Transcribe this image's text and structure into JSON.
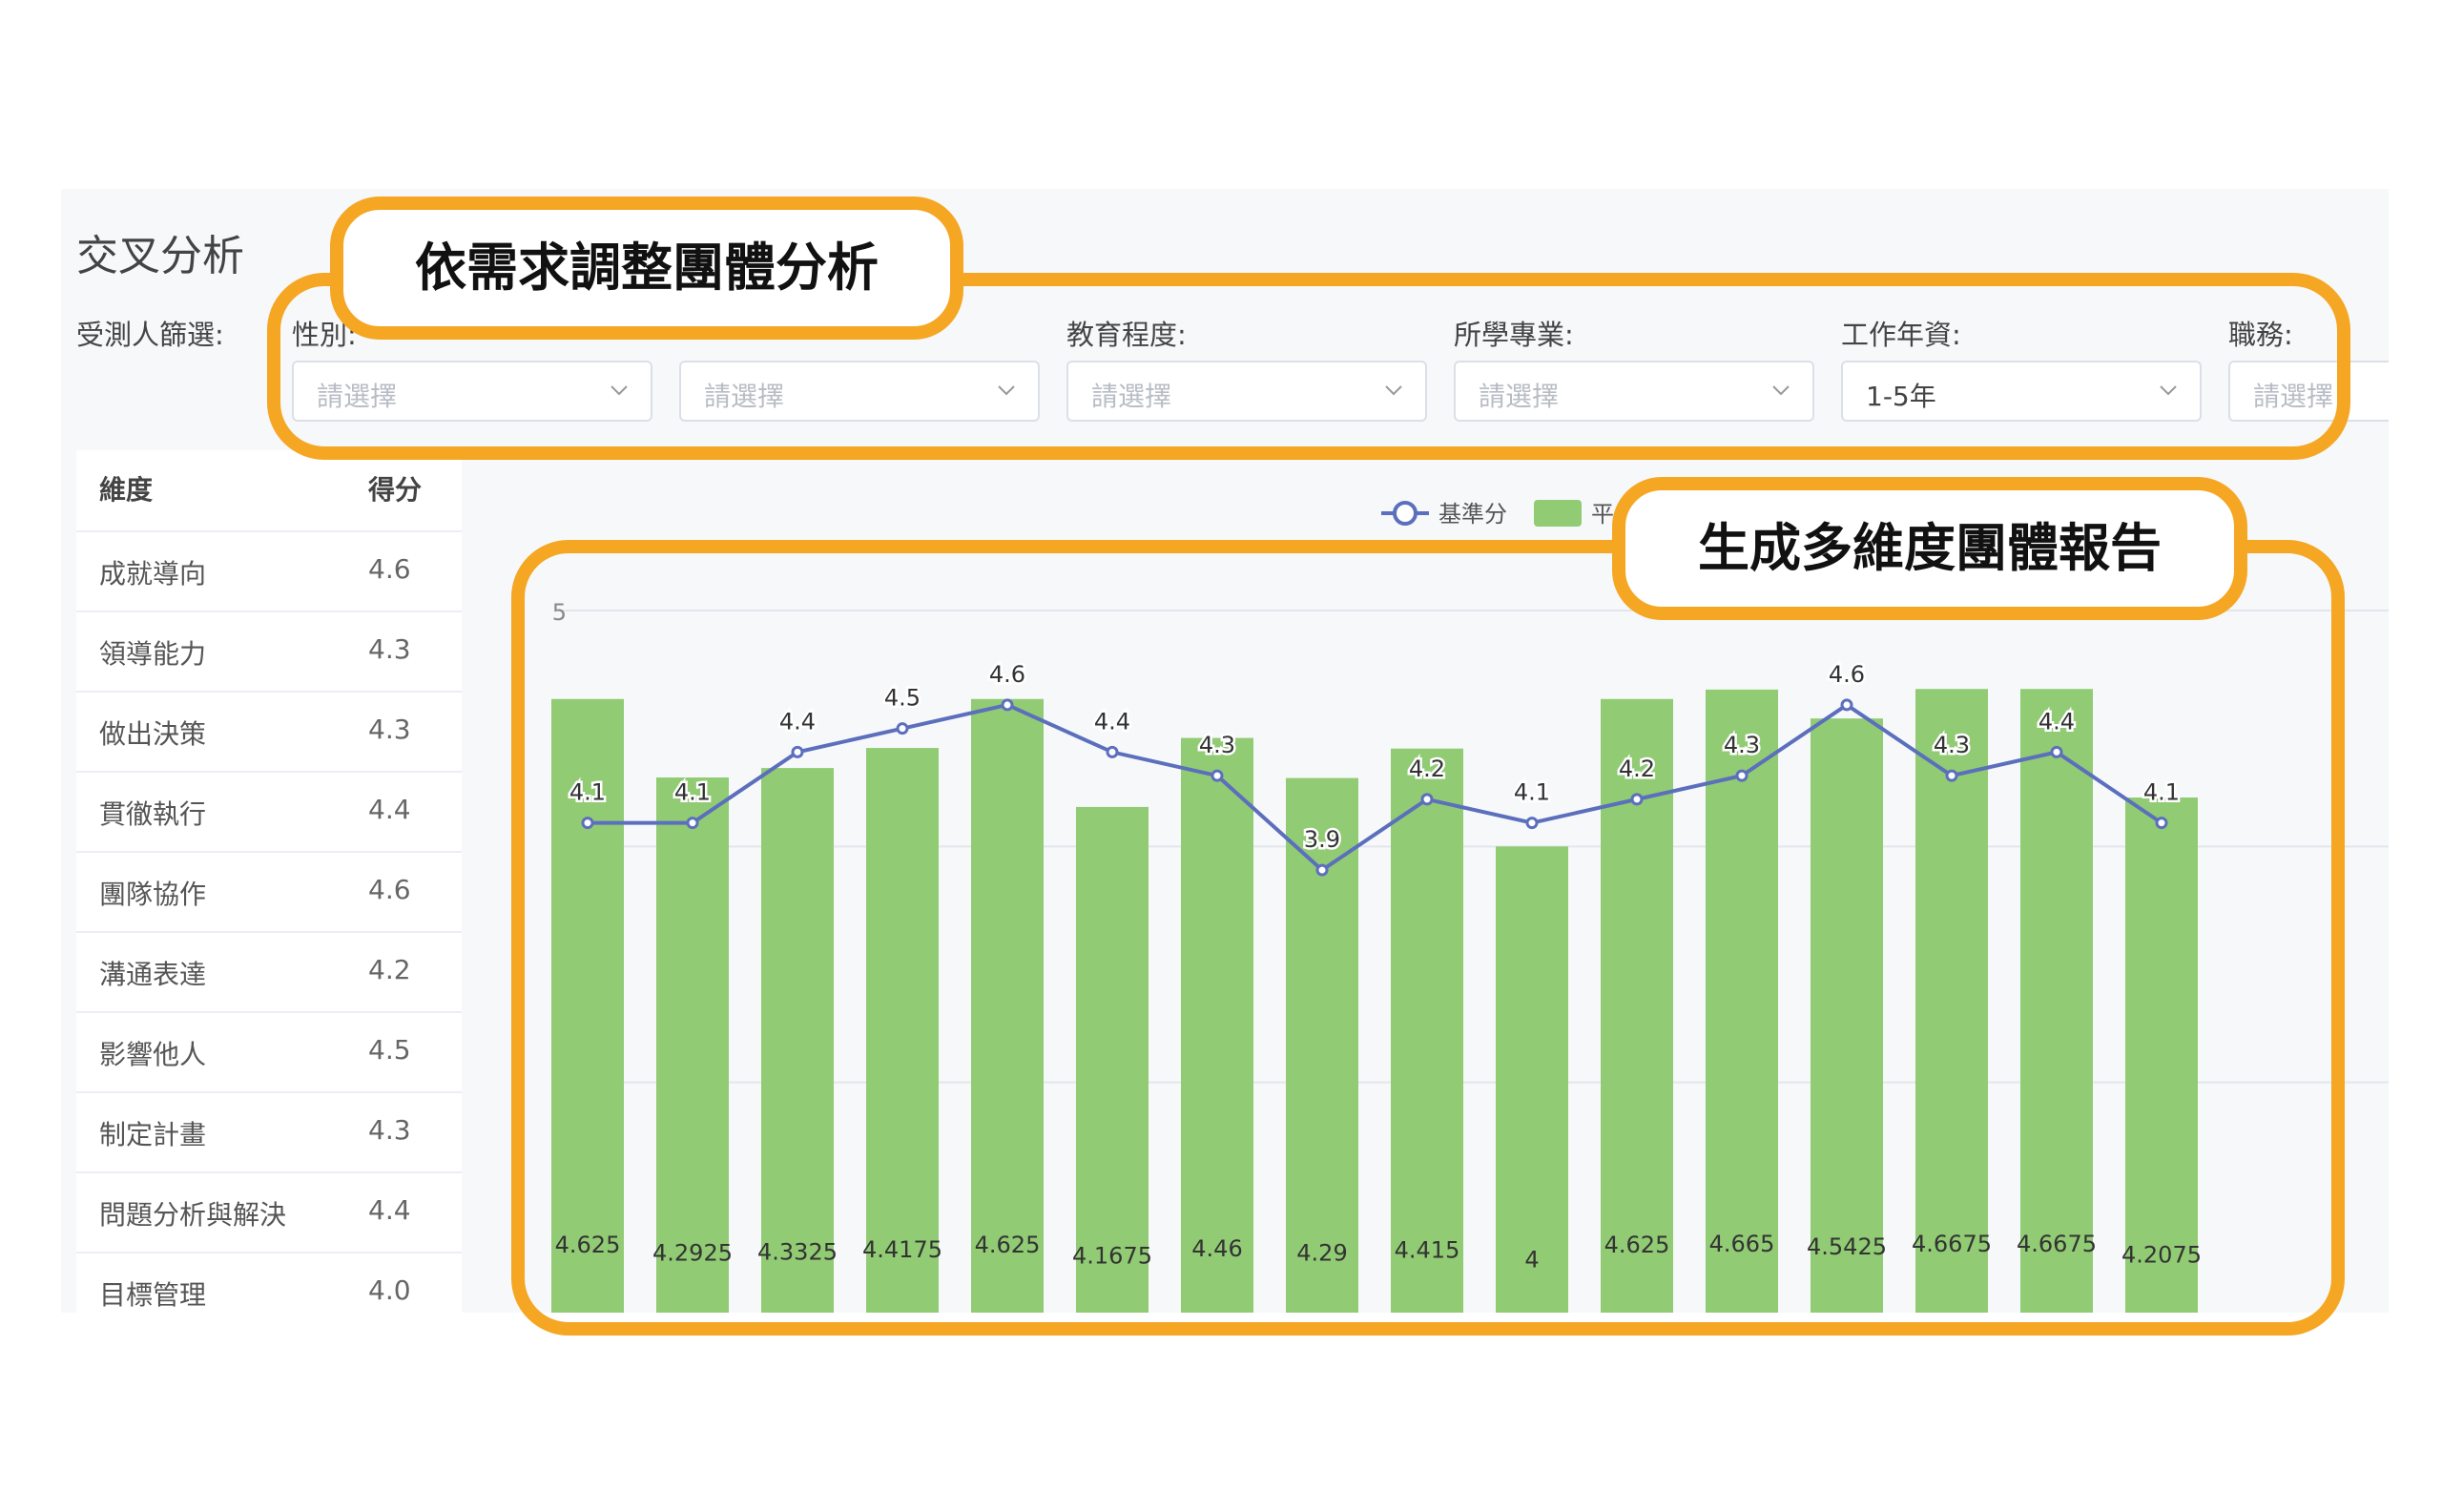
{
  "page": {
    "title": "交叉分析"
  },
  "filters": {
    "label": "受測人篩選:",
    "items": [
      {
        "label": "性別:",
        "value": "請選擇",
        "filled": false
      },
      {
        "label": "",
        "value": "請選擇",
        "filled": false
      },
      {
        "label": "教育程度:",
        "value": "請選擇",
        "filled": false
      },
      {
        "label": "所學專業:",
        "value": "請選擇",
        "filled": false
      },
      {
        "label": "工作年資:",
        "value": "1-5年",
        "filled": true
      },
      {
        "label": "職務:",
        "value": "請選擇",
        "filled": false
      }
    ]
  },
  "table": {
    "headers": {
      "dimension": "維度",
      "score": "得分"
    },
    "rows": [
      {
        "dimension": "成就導向",
        "score": "4.6"
      },
      {
        "dimension": "領導能力",
        "score": "4.3"
      },
      {
        "dimension": "做出決策",
        "score": "4.3"
      },
      {
        "dimension": "貫徹執行",
        "score": "4.4"
      },
      {
        "dimension": "團隊協作",
        "score": "4.6"
      },
      {
        "dimension": "溝通表達",
        "score": "4.2"
      },
      {
        "dimension": "影響他人",
        "score": "4.5"
      },
      {
        "dimension": "制定計畫",
        "score": "4.3"
      },
      {
        "dimension": "問題分析與解決",
        "score": "4.4"
      },
      {
        "dimension": "目標管理",
        "score": "4.0"
      }
    ]
  },
  "callouts": {
    "filter_note": "依需求調整團體分析",
    "report_note": "生成多維度團體報告"
  },
  "colors": {
    "bar": "#91cb74",
    "line": "#5b6fbd",
    "highlight": "#f5a623"
  },
  "chart_data": {
    "type": "bar",
    "legend": {
      "position": "top-center",
      "entries": [
        "基準分",
        "平"
      ]
    },
    "ylim": [
      2,
      5
    ],
    "yticks": [
      2,
      3,
      4,
      5
    ],
    "series": [
      {
        "name": "平",
        "type": "bar",
        "values": [
          4.625,
          4.2925,
          4.3325,
          4.4175,
          4.625,
          4.1675,
          4.46,
          4.29,
          4.415,
          4,
          4.625,
          4.665,
          4.5425,
          4.6675,
          4.6675,
          4.2075
        ]
      },
      {
        "name": "基準分",
        "type": "line",
        "values": [
          4.1,
          4.1,
          4.4,
          4.5,
          4.6,
          4.4,
          4.3,
          3.9,
          4.2,
          4.1,
          4.2,
          4.3,
          4.6,
          4.3,
          4.4,
          4.1
        ]
      }
    ]
  }
}
